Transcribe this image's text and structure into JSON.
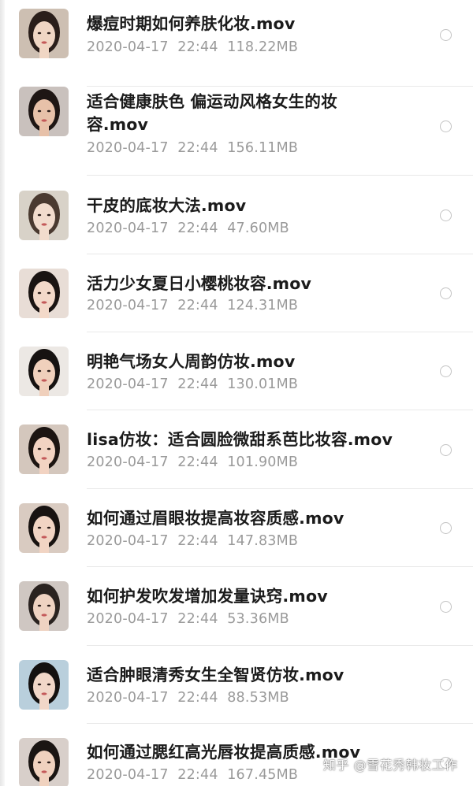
{
  "files": [
    {
      "name": "爆痘时期如何养肤化妆.mov",
      "date": "2020-04-17",
      "time": "22:44",
      "size": "118.22MB",
      "thumb_bg": "#cdbfb2",
      "thumb_skin": "#f0d6c4",
      "thumb_hair": "#2a1e1a"
    },
    {
      "name": "适合健康肤色 偏运动风格女生的妆容.mov",
      "date": "2020-04-17",
      "time": "22:44",
      "size": "156.11MB",
      "thumb_bg": "#c9c1bd",
      "thumb_skin": "#e7c1a9",
      "thumb_hair": "#1e1614"
    },
    {
      "name": "干皮的底妆大法.mov",
      "date": "2020-04-17",
      "time": "22:44",
      "size": "47.60MB",
      "thumb_bg": "#d8d2c8",
      "thumb_skin": "#f2dccd",
      "thumb_hair": "#4a3a30"
    },
    {
      "name": "活力少女夏日小樱桃妆容.mov",
      "date": "2020-04-17",
      "time": "22:44",
      "size": "124.31MB",
      "thumb_bg": "#e8ddd6",
      "thumb_skin": "#f3d9c9",
      "thumb_hair": "#1a1412"
    },
    {
      "name": "明艳气场女人周韵仿妆.mov",
      "date": "2020-04-17",
      "time": "22:44",
      "size": "130.01MB",
      "thumb_bg": "#ece8e4",
      "thumb_skin": "#f0d0bc",
      "thumb_hair": "#161211"
    },
    {
      "name": "lisa仿妆：适合圆脸微甜系芭比妆容.mov",
      "date": "2020-04-17",
      "time": "22:44",
      "size": "101.90MB",
      "thumb_bg": "#d4c7bd",
      "thumb_skin": "#f2d3c2",
      "thumb_hair": "#1c1512"
    },
    {
      "name": "如何通过眉眼妆提高妆容质感.mov",
      "date": "2020-04-17",
      "time": "22:44",
      "size": "147.83MB",
      "thumb_bg": "#d9cbc1",
      "thumb_skin": "#f1d4c3",
      "thumb_hair": "#181311"
    },
    {
      "name": "如何护发吹发增加发量诀窍.mov",
      "date": "2020-04-17",
      "time": "22:44",
      "size": "53.36MB",
      "thumb_bg": "#cfc7c2",
      "thumb_skin": "#efd3c2",
      "thumb_hair": "#2a2320"
    },
    {
      "name": "适合肿眼清秀女生全智贤仿妆.mov",
      "date": "2020-04-17",
      "time": "22:44",
      "size": "88.53MB",
      "thumb_bg": "#b9cfdc",
      "thumb_skin": "#f1d7c8",
      "thumb_hair": "#141110"
    },
    {
      "name": "如何通过腮红高光唇妆提高质感.mov",
      "date": "2020-04-17",
      "time": "22:44",
      "size": "167.45MB",
      "thumb_bg": "#d8cfca",
      "thumb_skin": "#f0d2bf",
      "thumb_hair": "#1a1513"
    }
  ],
  "watermark": "知乎 @雪花秀韩妆工作"
}
